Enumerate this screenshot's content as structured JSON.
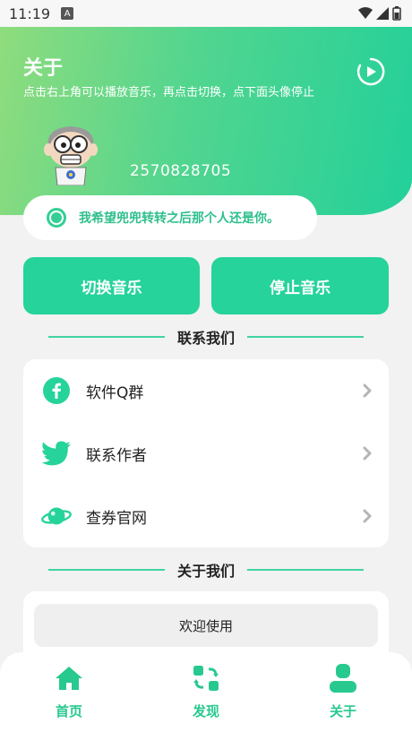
{
  "status_bar": {
    "time": "11:19",
    "badge": "A"
  },
  "hero": {
    "title": "关于",
    "subtitle": "点击右上角可以播放音乐，再点击切换，点下面头像停止",
    "qq_number": "2570828705",
    "play_icon": "play-circle-icon",
    "avatar_icon": "cartoon-avatar-icon"
  },
  "quote": {
    "text": "我希望兜兜转转之后那个人还是你。"
  },
  "buttons": {
    "switch_music": "切换音乐",
    "stop_music": "停止音乐"
  },
  "contact_section": {
    "title": "联系我们",
    "items": [
      {
        "label": "软件Q群",
        "icon": "facebook-icon"
      },
      {
        "label": "联系作者",
        "icon": "twitter-icon"
      },
      {
        "label": "查券官网",
        "icon": "planet-icon"
      }
    ]
  },
  "about_section": {
    "title": "关于我们",
    "welcome": "欢迎使用"
  },
  "tabbar": {
    "items": [
      {
        "label": "首页",
        "icon": "home-icon"
      },
      {
        "label": "发现",
        "icon": "discover-icon"
      },
      {
        "label": "关于",
        "icon": "user-icon"
      }
    ]
  },
  "colors": {
    "accent": "#26d39b",
    "gradient_start": "#8fdc7d",
    "gradient_end": "#23d09a",
    "tab_label": "#28c98f"
  }
}
